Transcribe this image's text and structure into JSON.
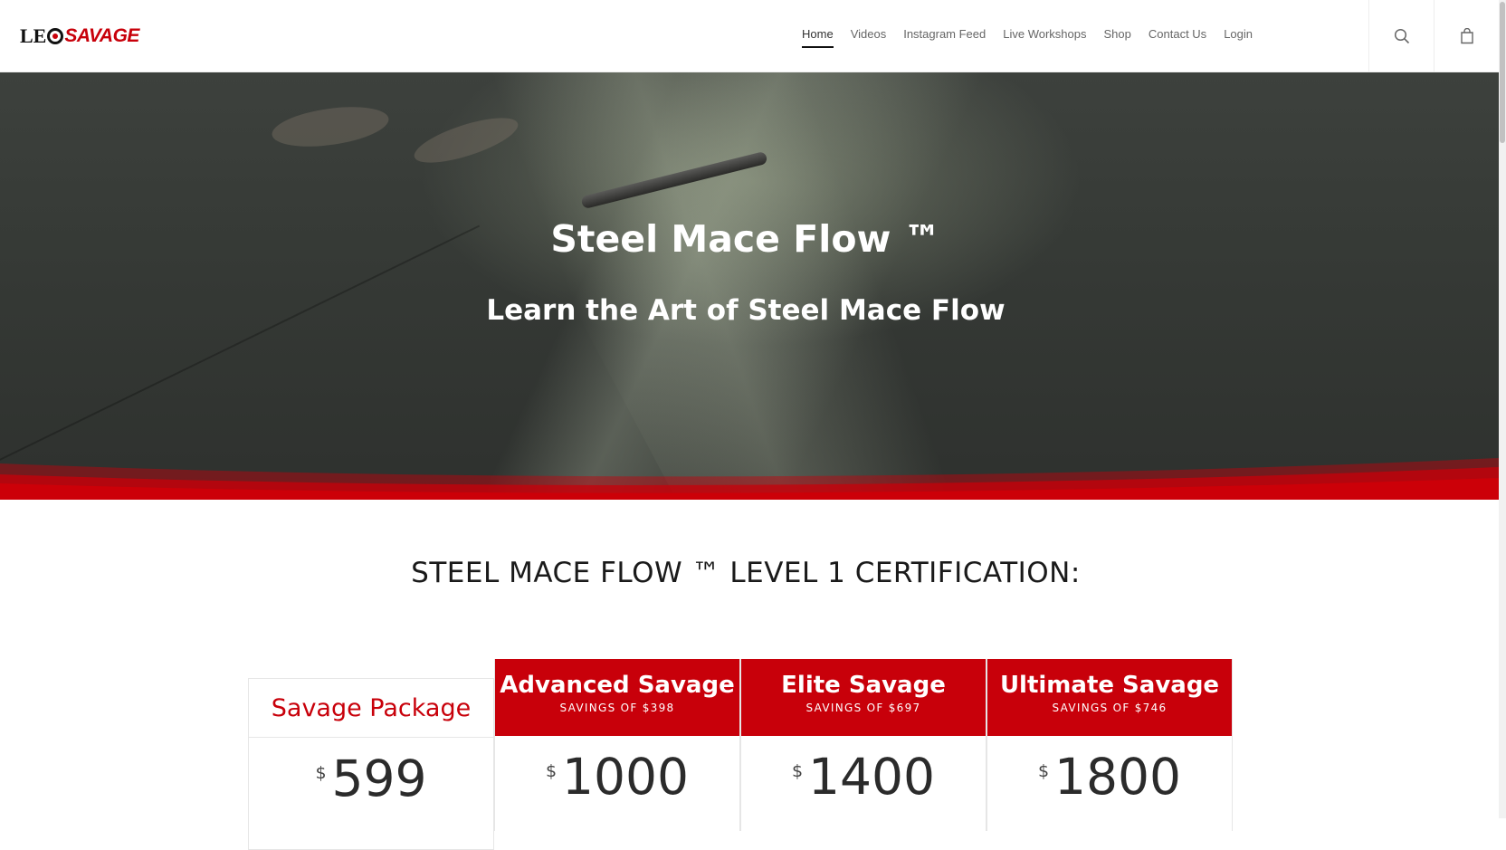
{
  "logo": {
    "part1": "LE",
    "part2": "SAVAGE"
  },
  "nav": {
    "items": [
      {
        "label": "Home",
        "active": true
      },
      {
        "label": "Videos"
      },
      {
        "label": "Instagram Feed"
      },
      {
        "label": "Live Workshops"
      },
      {
        "label": "Shop"
      },
      {
        "label": "Contact Us"
      },
      {
        "label": "Login"
      }
    ]
  },
  "hero": {
    "title": "Steel Mace Flow ™",
    "subtitle": "Learn the Art of Steel Mace Flow"
  },
  "section": {
    "title": "STEEL MACE FLOW ™ LEVEL 1 CERTIFICATION:"
  },
  "plans": [
    {
      "name": "Savage Package",
      "savings": "",
      "currency": "$",
      "price": "599"
    },
    {
      "name": "Advanced Savage",
      "savings": "SAVINGS OF $398",
      "currency": "$",
      "price": "1000"
    },
    {
      "name": "Elite Savage",
      "savings": "SAVINGS OF $697",
      "currency": "$",
      "price": "1400"
    },
    {
      "name": "Ultimate Savage",
      "savings": "SAVINGS OF $746",
      "currency": "$",
      "price": "1800"
    }
  ],
  "colors": {
    "accent": "#c8000a",
    "hero_dark": "#363a36"
  }
}
